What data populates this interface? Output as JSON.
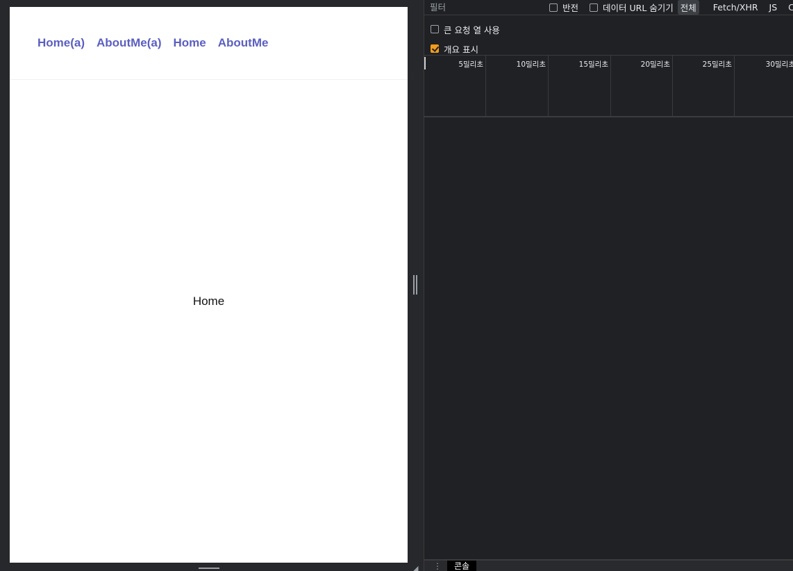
{
  "page": {
    "nav": {
      "links": [
        "Home(a)",
        "AboutMe(a)",
        "Home",
        "AboutMe"
      ]
    },
    "content_text": "Home"
  },
  "devtools": {
    "filter_placeholder": "필터",
    "invert_label": "반전",
    "hide_data_url_label": "데이터 URL 숨기기",
    "type_filters": [
      "전체",
      "Fetch/XHR",
      "JS",
      "C"
    ],
    "active_type_filter": "전체",
    "options": {
      "big_request_rows_label": "큰 요청 열 사용",
      "big_request_rows_checked": false,
      "show_overview_label": "개요 표시",
      "show_overview_checked": true
    },
    "timeline_ticks": [
      "5밀리초",
      "10밀리초",
      "15밀리초",
      "20밀리초",
      "25밀리초",
      "30밀리초"
    ],
    "drawer_tab": "콘솔",
    "colors": {
      "accent_checkbox": "#f29d1a",
      "nav_link": "#5b5fc0",
      "panel_bg": "#202124"
    }
  }
}
